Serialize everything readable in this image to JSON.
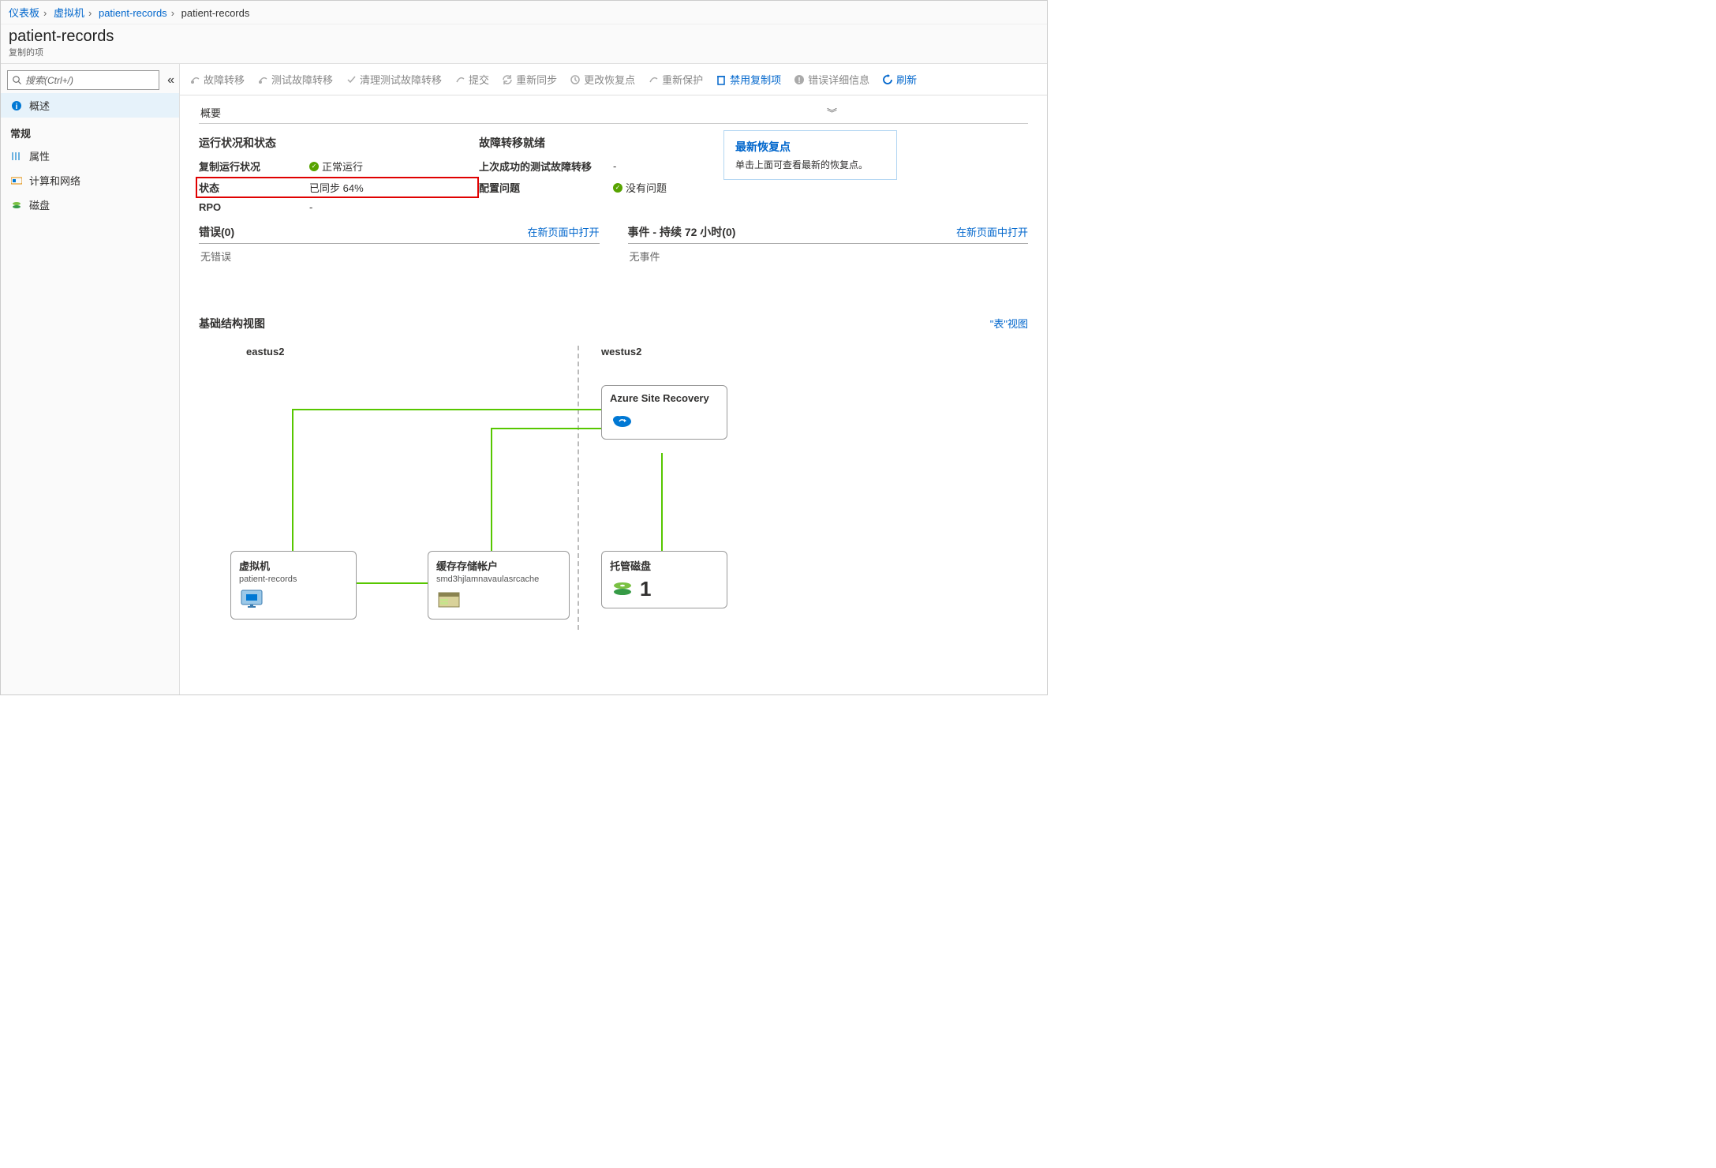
{
  "breadcrumb": {
    "b0": "仪表板",
    "b1": "虚拟机",
    "b2": "patient-records",
    "b3": "patient-records"
  },
  "header": {
    "title": "patient-records",
    "subtitle": "复制的项"
  },
  "search": {
    "placeholder": "搜索(Ctrl+/)"
  },
  "nav": {
    "overview": "概述",
    "section_general": "常规",
    "properties": "属性",
    "compute": "计算和网络",
    "disks": "磁盘"
  },
  "toolbar": {
    "failover": "故障转移",
    "test_failover": "测试故障转移",
    "cleanup": "清理测试故障转移",
    "commit": "提交",
    "resync": "重新同步",
    "change_rp": "更改恢复点",
    "reprotect": "重新保护",
    "disable": "禁用复制项",
    "error_detail": "错误详细信息",
    "refresh": "刷新"
  },
  "summary_label": "概要",
  "health": {
    "title": "运行状况和状态",
    "replication_health_k": "复制运行状况",
    "replication_health_v": "正常运行",
    "status_k": "状态",
    "status_v": "已同步 64%",
    "rpo_k": "RPO",
    "rpo_v": "-"
  },
  "readiness": {
    "title": "故障转移就绪",
    "last_test_k": "上次成功的测试故障转移",
    "last_test_v": "-",
    "config_k": "配置问题",
    "config_v": "没有问题"
  },
  "tip": {
    "title": "最新恢复点",
    "desc": "单击上面可查看最新的恢复点。"
  },
  "errors": {
    "title": "错误(0)",
    "open": "在新页面中打开",
    "body": "无错误"
  },
  "events": {
    "title": "事件 - 持续 72 小时(0)",
    "open": "在新页面中打开",
    "body": "无事件"
  },
  "infra": {
    "title": "基础结构视图",
    "table_view": "\"表\"视图",
    "region1": "eastus2",
    "region2": "westus2",
    "asr": "Azure Site Recovery",
    "vm_t": "虚拟机",
    "vm_s": "patient-records",
    "cache_t": "缓存存储帐户",
    "cache_s": "smd3hjlamnavaulasrcache",
    "disk_t": "托管磁盘",
    "disk_count": "1"
  }
}
